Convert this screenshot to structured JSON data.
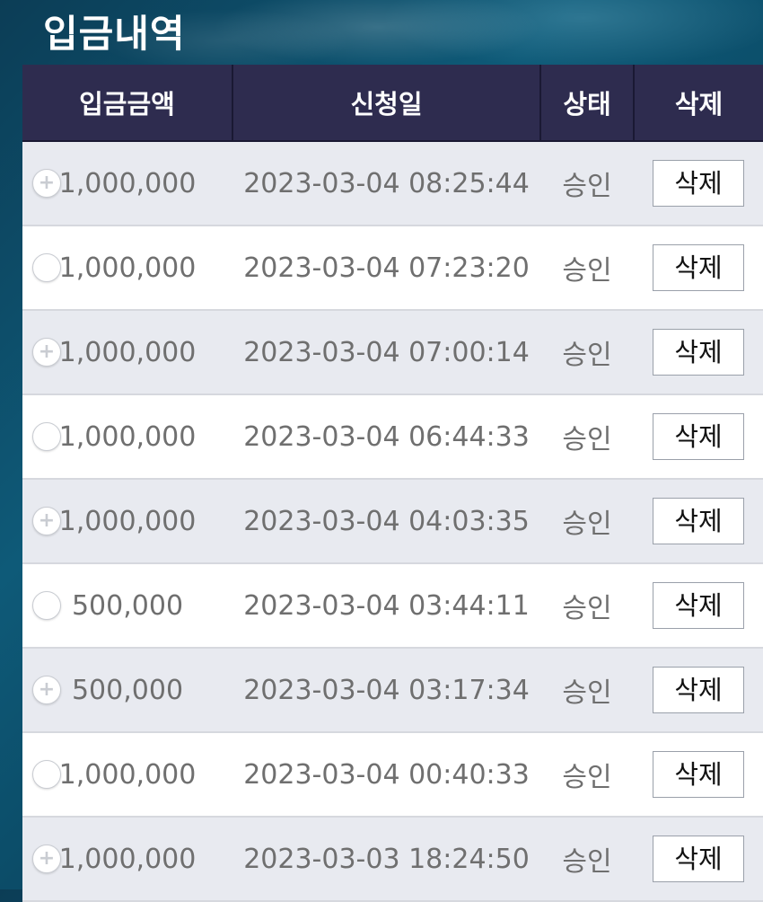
{
  "page": {
    "title": "입금내역"
  },
  "table": {
    "headers": {
      "amount": "입금금액",
      "date": "신청일",
      "status": "상태",
      "delete": "삭제"
    },
    "rows": [
      {
        "amount": "1,000,000",
        "date": "2023-03-04 08:25:44",
        "status": "승인",
        "delete_label": "삭제",
        "toggle_icon": "plus-circle-icon"
      },
      {
        "amount": "1,000,000",
        "date": "2023-03-04 07:23:20",
        "status": "승인",
        "delete_label": "삭제",
        "toggle_icon": "circle-icon"
      },
      {
        "amount": "1,000,000",
        "date": "2023-03-04 07:00:14",
        "status": "승인",
        "delete_label": "삭제",
        "toggle_icon": "plus-circle-icon"
      },
      {
        "amount": "1,000,000",
        "date": "2023-03-04 06:44:33",
        "status": "승인",
        "delete_label": "삭제",
        "toggle_icon": "circle-icon"
      },
      {
        "amount": "1,000,000",
        "date": "2023-03-04 04:03:35",
        "status": "승인",
        "delete_label": "삭제",
        "toggle_icon": "plus-circle-icon"
      },
      {
        "amount": "500,000",
        "date": "2023-03-04 03:44:11",
        "status": "승인",
        "delete_label": "삭제",
        "toggle_icon": "circle-icon"
      },
      {
        "amount": "500,000",
        "date": "2023-03-04 03:17:34",
        "status": "승인",
        "delete_label": "삭제",
        "toggle_icon": "plus-circle-icon"
      },
      {
        "amount": "1,000,000",
        "date": "2023-03-04 00:40:33",
        "status": "승인",
        "delete_label": "삭제",
        "toggle_icon": "circle-icon"
      },
      {
        "amount": "1,000,000",
        "date": "2023-03-03 18:24:50",
        "status": "승인",
        "delete_label": "삭제",
        "toggle_icon": "plus-circle-icon"
      }
    ]
  },
  "colors": {
    "header_bg": "#2e2c4f",
    "row_alt_bg": "#e8eaf0",
    "row_bg": "#ffffff",
    "text_gray": "#6f6f6f"
  }
}
